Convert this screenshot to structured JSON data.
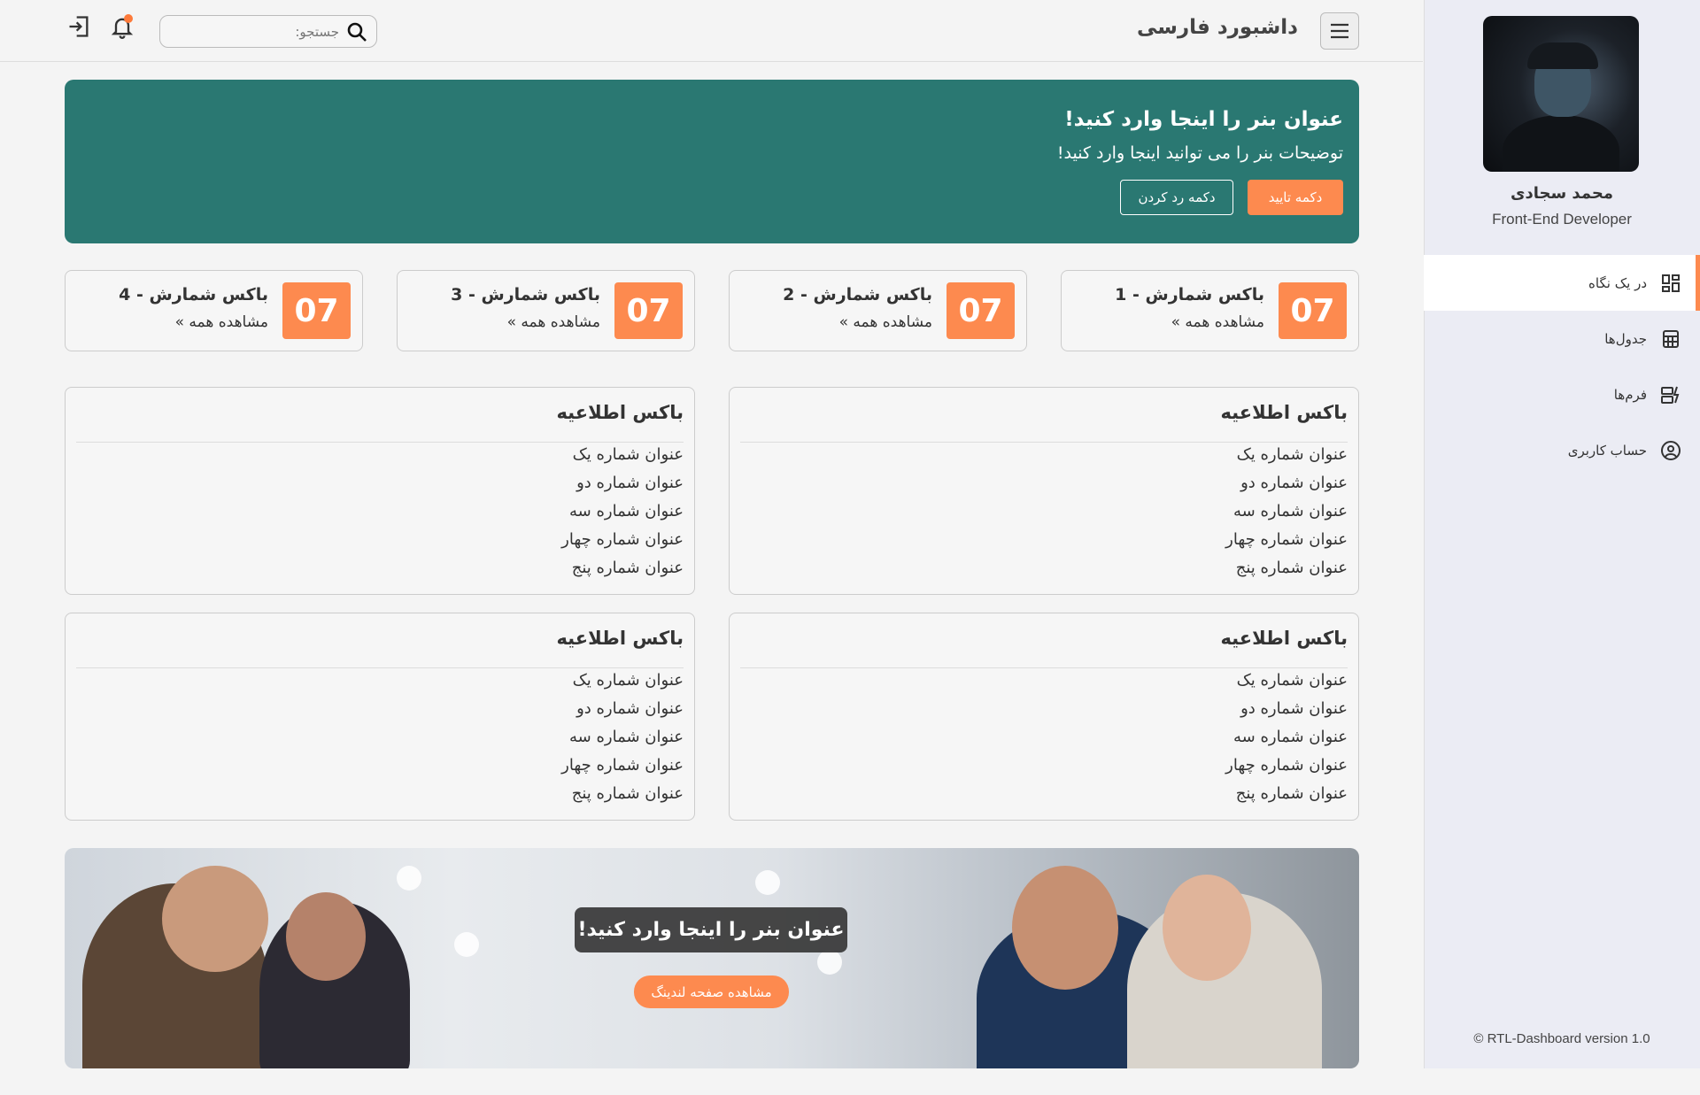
{
  "sidebar": {
    "user_name": "محمد سجادی",
    "user_role": "Front-End Developer",
    "items": [
      {
        "label": "در یک نگاه",
        "icon": "dashboard-grid-icon",
        "active": true
      },
      {
        "label": "جدول‌ها",
        "icon": "calculator-table-icon",
        "active": false
      },
      {
        "label": "فرم‌ها",
        "icon": "form-bolt-icon",
        "active": false
      },
      {
        "label": "حساب کاربری",
        "icon": "user-circle-icon",
        "active": false
      }
    ],
    "footer": "© RTL-Dashboard version 1.0"
  },
  "topbar": {
    "title": "داشبورد فارسی",
    "search_placeholder": "جستجو:",
    "notification_dot": true
  },
  "hero": {
    "title": "عنوان بنر را اینجا وارد کنید!",
    "description": "توضیحات بنر را می توانید اینجا وارد کنید!",
    "confirm_label": "دکمه تایید",
    "reject_label": "دکمه رد کردن"
  },
  "counters": [
    {
      "number": "07",
      "title": "باکس شمارش - 1",
      "link": "مشاهده همه »"
    },
    {
      "number": "07",
      "title": "باکس شمارش - 2",
      "link": "مشاهده همه »"
    },
    {
      "number": "07",
      "title": "باکس شمارش - 3",
      "link": "مشاهده همه »"
    },
    {
      "number": "07",
      "title": "باکس شمارش - 4",
      "link": "مشاهده همه »"
    }
  ],
  "infoboxes": [
    {
      "title": "باکس اطلاعیه",
      "items": [
        "عنوان شماره یک",
        "عنوان شماره دو",
        "عنوان شماره سه",
        "عنوان شماره چهار",
        "عنوان شماره پنج"
      ]
    },
    {
      "title": "باکس اطلاعیه",
      "items": [
        "عنوان شماره یک",
        "عنوان شماره دو",
        "عنوان شماره سه",
        "عنوان شماره چهار",
        "عنوان شماره پنج"
      ]
    },
    {
      "title": "باکس اطلاعیه",
      "items": [
        "عنوان شماره یک",
        "عنوان شماره دو",
        "عنوان شماره سه",
        "عنوان شماره چهار",
        "عنوان شماره پنج"
      ]
    },
    {
      "title": "باکس اطلاعیه",
      "items": [
        "عنوان شماره یک",
        "عنوان شماره دو",
        "عنوان شماره سه",
        "عنوان شماره چهار",
        "عنوان شماره پنج"
      ]
    }
  ],
  "bottom_banner": {
    "title": "عنوان بنر را اینجا وارد کنید!",
    "cta_label": "مشاهده صفحه لندینگ"
  },
  "colors": {
    "accent": "#fd8a4f",
    "hero_bg": "#2a7872",
    "sidebar_bg": "#ebecf4"
  }
}
